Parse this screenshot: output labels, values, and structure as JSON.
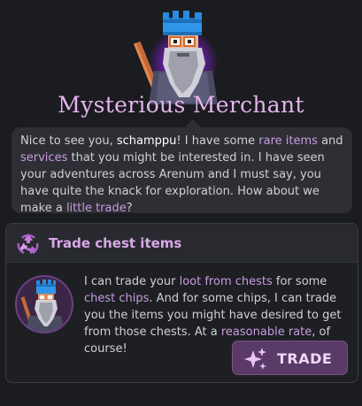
{
  "merchant": {
    "title": "Mysterious Merchant"
  },
  "dialog": {
    "segments": [
      {
        "text": "Nice to see you, ",
        "style": "plain"
      },
      {
        "text": "schamppu",
        "style": "name"
      },
      {
        "text": "! I have some ",
        "style": "plain"
      },
      {
        "text": "rare items",
        "style": "highlight"
      },
      {
        "text": " and ",
        "style": "plain"
      },
      {
        "text": "services",
        "style": "highlight"
      },
      {
        "text": " that you might be interested in. I have seen your adventures across Arenum and I must say, you have quite the knack for exploration. How about we make a ",
        "style": "plain"
      },
      {
        "text": "little trade",
        "style": "highlight"
      },
      {
        "text": "?",
        "style": "plain"
      }
    ]
  },
  "trade_card": {
    "title": "Trade chest items",
    "segments": [
      {
        "text": "I can trade your ",
        "style": "plain"
      },
      {
        "text": "loot from chests",
        "style": "highlight"
      },
      {
        "text": " for some ",
        "style": "plain"
      },
      {
        "text": "chest chips",
        "style": "highlight"
      },
      {
        "text": ". And for some chips, I can trade you the items you might have desired to get from those chests. At a ",
        "style": "plain"
      },
      {
        "text": "reasonable rate",
        "style": "highlight"
      },
      {
        "text": ", of course!",
        "style": "plain"
      }
    ],
    "button_label": "TRADE",
    "icons": {
      "header": "recycle-icon",
      "button": "sparkle-icon",
      "avatar": "merchant-avatar"
    }
  },
  "colors": {
    "background": "#1a1c20",
    "accent": "#e5b4ec",
    "highlight": "#c99be0",
    "button": "#5a3a67"
  }
}
